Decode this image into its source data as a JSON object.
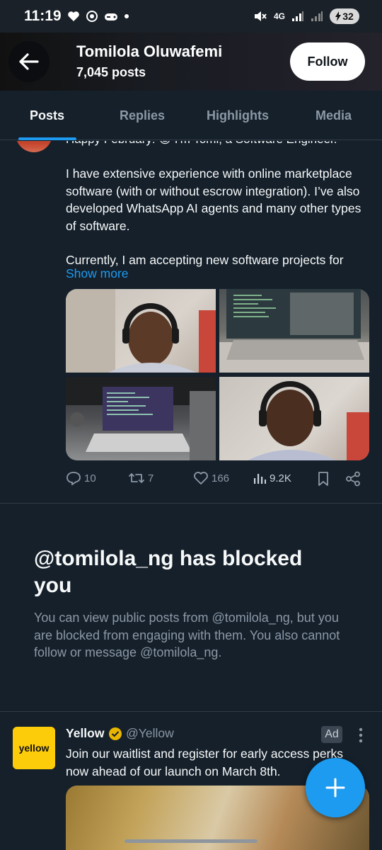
{
  "status_bar": {
    "time": "11:19",
    "network": "4G",
    "battery": "32"
  },
  "header": {
    "title": "Tomilola Oluwafemi",
    "subtitle": "7,045 posts",
    "follow_label": "Follow"
  },
  "tabs": [
    {
      "label": "Posts",
      "active": true
    },
    {
      "label": "Replies",
      "active": false
    },
    {
      "label": "Highlights",
      "active": false
    },
    {
      "label": "Media",
      "active": false
    }
  ],
  "tweet": {
    "cut_line": "Happy February! 😊 I'm Tomi, a Software Engineer.",
    "paragraph_1": "I have extensive experience with online marketplace software (with or without escrow integration). I’ve also developed WhatsApp AI agents and many other types of software.",
    "paragraph_2": "Currently, I am accepting new software projects for",
    "show_more": "Show more",
    "actions": {
      "replies": "10",
      "reposts": "7",
      "likes": "166",
      "views": "9.2K"
    }
  },
  "blocked": {
    "title": "@tomilola_ng has blocked you",
    "description": "You can view public posts from @tomilola_ng, but you are blocked from engaging with them. You also cannot follow or message @tomilola_ng."
  },
  "ad": {
    "logo_text": "yellow",
    "name": "Yellow",
    "handle": "@Yellow",
    "badge": "Ad",
    "text": "Join our waitlist and register for early access perks now ahead of our launch on March 8th."
  },
  "colors": {
    "background": "#15202b",
    "accent": "#1d9bf0",
    "muted_text": "#8b98a5",
    "ad_logo": "#fccc0b"
  }
}
